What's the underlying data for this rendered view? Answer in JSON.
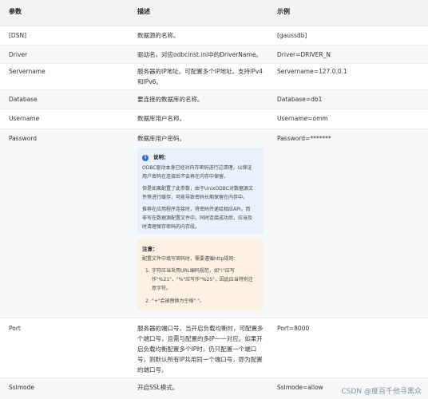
{
  "header": {
    "col_param": "参数",
    "col_desc": "描述",
    "col_example": "示例"
  },
  "rows": [
    {
      "param": "[DSN]",
      "desc": "数据源的名称。",
      "example": "[gaussdb]"
    },
    {
      "param": "Driver",
      "desc": "驱动名，对应odbcinst.ini中的DriverName。",
      "example": "Driver=DRIVER_N"
    },
    {
      "param": "Servername",
      "desc_line1": "服务器的IP地址。可配置多个IP地址。支持IPv4",
      "desc_line2": "和IPv6。",
      "example": "Servername=127.0.0.1"
    },
    {
      "param": "Database",
      "desc": "要连接的数据库的名称。",
      "example": "Database=db1"
    },
    {
      "param": "Username",
      "desc": "数据库用户名称。",
      "example": "Username=omm"
    },
    {
      "param": "Password",
      "desc": "数据库用户密码。",
      "example": "Password=*******"
    },
    {
      "param": "Port",
      "desc_lines": [
        "服务器的端口号。当开启负载均衡时，可配置多",
        "个端口号，且需与配置的多IP一一对应。如果开",
        "启负载均衡配置多个IP时，仍只配置一个端口",
        "号，则默认所有IP共用同一个端口号，即为配置",
        "的端口号。"
      ],
      "example": "Port=8000"
    },
    {
      "param": "Sslmode",
      "desc": "开启SSL模式。",
      "example": "Sslmode=allow"
    }
  ],
  "note_info": {
    "title": "说明：",
    "p1": [
      "ODBC驱动本身已经对内存密码进行过清理，以保证",
      "用户密码在连接后不会再在内存中保留。"
    ],
    "p2": [
      "但是如果配置了此参数，由于UnixODBC对数据源文",
      "件等进行缓存，可能导致密码长期保留在内存中。"
    ],
    "p3": [
      "推荐在应用程序连接时，将密码传递给相应API，而",
      "非写在数据源配置文件中。同时连接成功后，应当及",
      "时清理保存密码的内存段。"
    ]
  },
  "note_attention": {
    "title": "注意：",
    "intro": "配置文件中填写密码时，需要遵循http规则：",
    "items": [
      {
        "num": "1.",
        "lines": [
          "字符应当采用URL编码规范，如\"!\"应写",
          "作\"%21\"，\"%\"应写作\"%25\"，因此应当特别注",
          "意字符。"
        ]
      },
      {
        "num": "2.",
        "lines": [
          "\"+\"会被替换为空格\" \"。"
        ]
      }
    ]
  },
  "watermark": "CSDN @度百千他寻黑众"
}
